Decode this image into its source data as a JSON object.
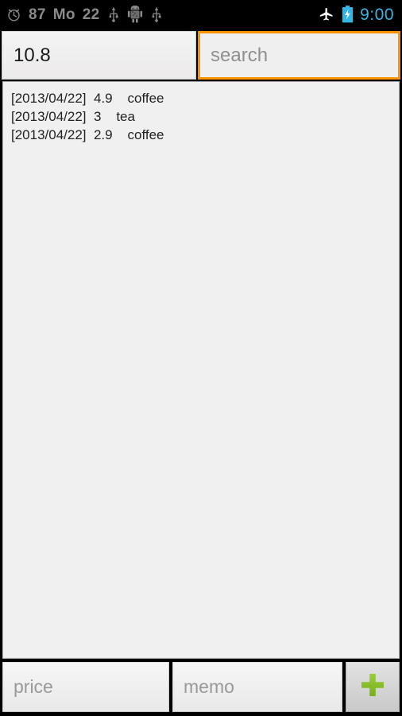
{
  "status_bar": {
    "alarm_icon": "alarm-clock-icon",
    "battery_percent": "87",
    "day_abbrev": "Mo",
    "day_number": "22",
    "usb_icon_1": "usb-icon",
    "android_debug_icon": "android-robot-icon",
    "usb_icon_2": "usb-icon",
    "airplane_icon": "airplane-mode-icon",
    "battery_icon": "battery-charging-icon",
    "clock": "9:00",
    "clock_color": "#33b5e5",
    "battery_icon_color": "#33b5e5",
    "text_color": "#8a8a8a"
  },
  "top_row": {
    "total_value": "10.8",
    "search_value": "",
    "search_placeholder": "search",
    "search_focus_color": "#ff9200"
  },
  "list": {
    "items": [
      "[2013/04/22]  4.9    coffee",
      "[2013/04/22]  3    tea",
      "[2013/04/22]  2.9    coffee"
    ]
  },
  "bottom_bar": {
    "price_value": "",
    "price_placeholder": "price",
    "memo_value": "",
    "memo_placeholder": "memo",
    "add_button_icon": "plus-icon",
    "add_button_icon_color": "#8bc233"
  }
}
